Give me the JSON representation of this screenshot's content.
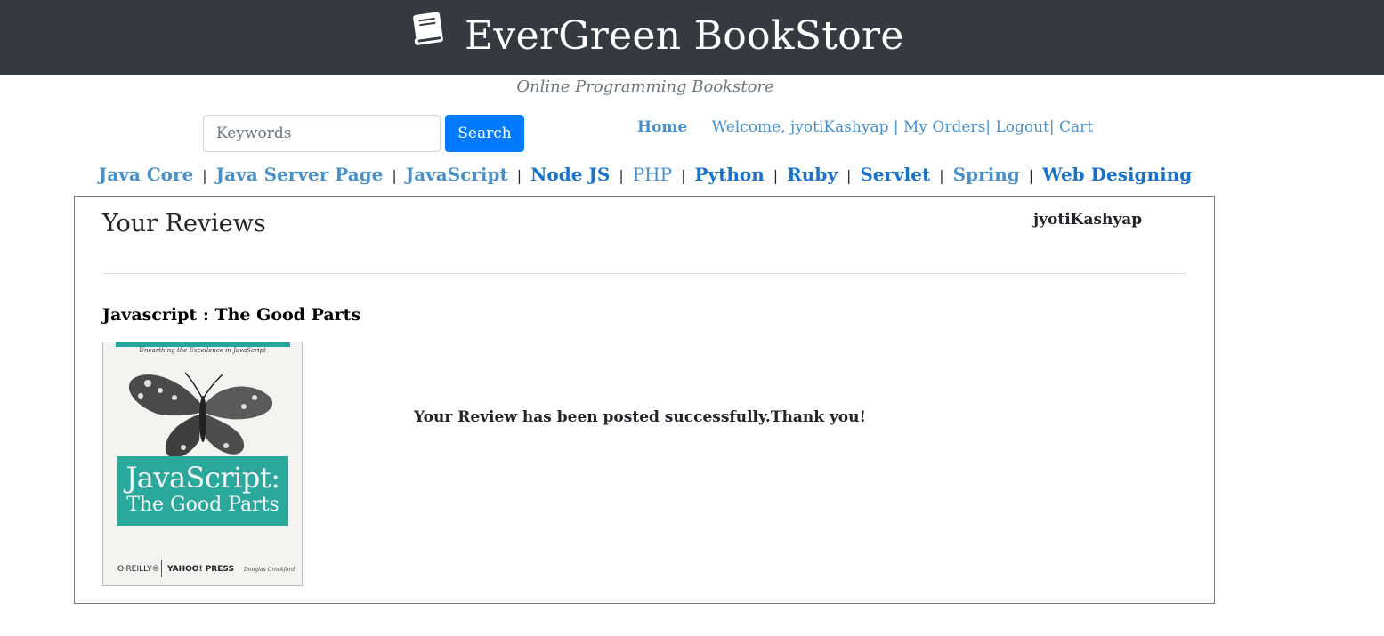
{
  "header": {
    "brand_icon": "book-icon",
    "title": "EverGreen BookStore",
    "tagline": "Online Programming Bookstore",
    "background_color": "#343a40"
  },
  "search": {
    "placeholder": "Keywords",
    "value": "",
    "button_label": "Search",
    "button_color": "#007bff"
  },
  "user_nav": {
    "home": "Home",
    "welcome": "Welcome, jyotiKashyap",
    "sep1": "|",
    "my_orders": "My Orders",
    "sep2": "|",
    "logout": "Logout",
    "sep3": "|",
    "cart": "Cart"
  },
  "categories": [
    "Java Core",
    "Java Server Page",
    "JavaScript",
    "Node JS",
    "PHP",
    "Python",
    "Ruby",
    "Servlet",
    "Spring",
    "Web Designing"
  ],
  "category_separator": "|",
  "reviews": {
    "heading": "Your Reviews",
    "username": "jyotiKashyap",
    "book_title": "Javascript : The Good Parts",
    "message": "Your Review has been posted successfully.Thank you!",
    "cover": {
      "subtitle": "Unearthing the Excellence in JavaScript",
      "title_line1": "JavaScript:",
      "title_line2": "The Good Parts",
      "publisher": "O'REILLY®",
      "partner": "YAHOO! PRESS",
      "author": "Douglas Crockford",
      "accent_color": "#2aa89c"
    }
  }
}
